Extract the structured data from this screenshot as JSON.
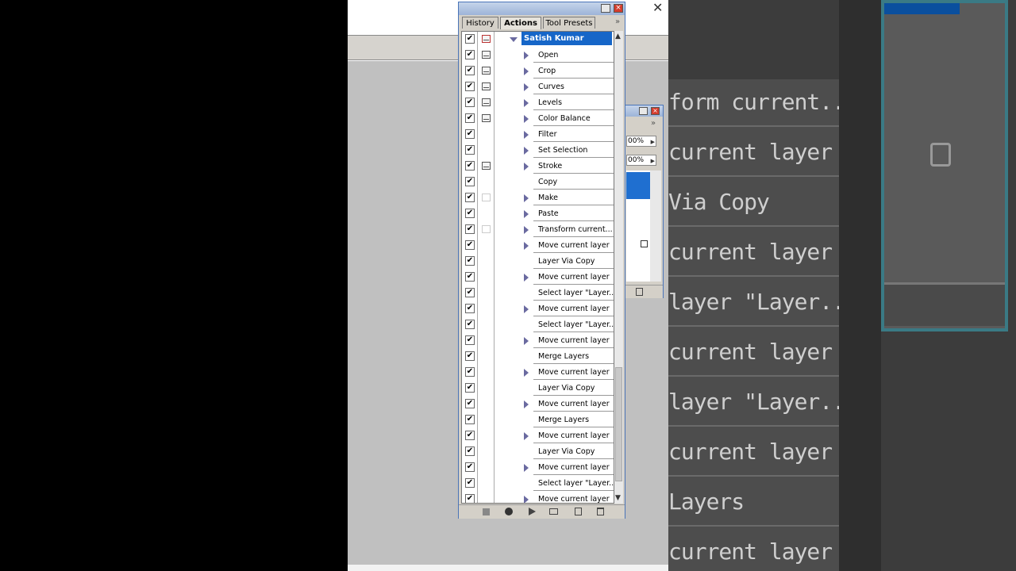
{
  "palette": {
    "tabs": [
      {
        "label": "History"
      },
      {
        "label": "Actions"
      },
      {
        "label": "Tool Presets"
      }
    ],
    "more_label": "»",
    "close_label": "×",
    "action_set": "Satish Kumar",
    "actions": [
      {
        "label": "Open",
        "expandable": true,
        "dialog": "on"
      },
      {
        "label": "Crop",
        "expandable": true,
        "dialog": "on"
      },
      {
        "label": "Curves",
        "expandable": true,
        "dialog": "on"
      },
      {
        "label": "Levels",
        "expandable": true,
        "dialog": "on"
      },
      {
        "label": "Color Balance",
        "expandable": true,
        "dialog": "on"
      },
      {
        "label": "Filter",
        "expandable": true,
        "dialog": "none"
      },
      {
        "label": "Set Selection",
        "expandable": true,
        "dialog": "none"
      },
      {
        "label": "Stroke",
        "expandable": true,
        "dialog": "on"
      },
      {
        "label": "Copy",
        "expandable": false,
        "dialog": "none"
      },
      {
        "label": "Make",
        "expandable": true,
        "dialog": "off"
      },
      {
        "label": "Paste",
        "expandable": true,
        "dialog": "none"
      },
      {
        "label": "Transform current...",
        "expandable": true,
        "dialog": "off"
      },
      {
        "label": "Move current layer",
        "expandable": true,
        "dialog": "none"
      },
      {
        "label": "Layer Via Copy",
        "expandable": false,
        "dialog": "none"
      },
      {
        "label": "Move current layer",
        "expandable": true,
        "dialog": "none"
      },
      {
        "label": "Select layer \"Layer...",
        "expandable": false,
        "dialog": "none"
      },
      {
        "label": "Move current layer",
        "expandable": true,
        "dialog": "none"
      },
      {
        "label": "Select layer \"Layer...",
        "expandable": false,
        "dialog": "none"
      },
      {
        "label": "Move current layer",
        "expandable": true,
        "dialog": "none"
      },
      {
        "label": "Merge Layers",
        "expandable": false,
        "dialog": "none"
      },
      {
        "label": "Move current layer",
        "expandable": true,
        "dialog": "none"
      },
      {
        "label": "Layer Via Copy",
        "expandable": false,
        "dialog": "none"
      },
      {
        "label": "Move current layer",
        "expandable": true,
        "dialog": "none"
      },
      {
        "label": "Merge Layers",
        "expandable": false,
        "dialog": "none"
      },
      {
        "label": "Move current layer",
        "expandable": true,
        "dialog": "none"
      },
      {
        "label": "Layer Via Copy",
        "expandable": false,
        "dialog": "none"
      },
      {
        "label": "Move current layer",
        "expandable": true,
        "dialog": "none"
      },
      {
        "label": "Select layer \"Layer...",
        "expandable": false,
        "dialog": "none"
      },
      {
        "label": "Move current layer",
        "expandable": true,
        "dialog": "none"
      }
    ],
    "check_mark": "✔"
  },
  "layers_panel": {
    "opacity": "00%",
    "fill": "00%",
    "more_label": "»",
    "close_label": "×"
  },
  "document": {
    "close_label": "✕"
  },
  "zoom_bg": {
    "rows": [
      "form current...",
      "current layer",
      "Via Copy",
      "current layer",
      "layer \"Layer...",
      "current layer",
      "layer \"Layer...",
      "current layer",
      "Layers",
      "current layer"
    ]
  },
  "colors": {
    "accent": "#1666c8",
    "titlebar": "#9db4d8",
    "close": "#d43c2c"
  }
}
